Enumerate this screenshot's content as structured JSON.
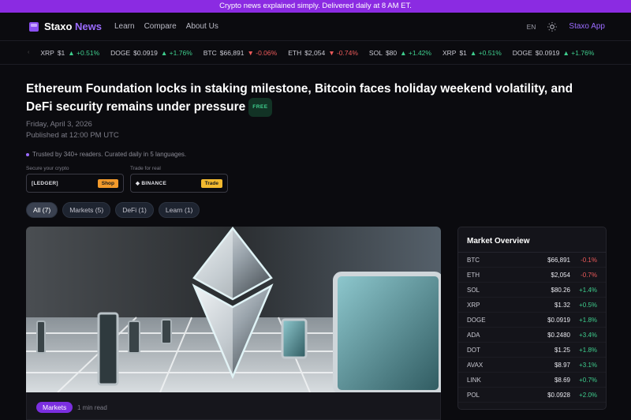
{
  "banner": {
    "text": "Crypto news explained simply. Delivered daily at 8 AM ET."
  },
  "nav": {
    "brand_main": "Staxo",
    "brand_accent": " News",
    "links": [
      "Learn",
      "Compare",
      "About Us"
    ],
    "lang": "EN",
    "theme_icon": "sun-icon",
    "app_link": "Staxo App"
  },
  "ticker": {
    "separator": "‹",
    "items": [
      {
        "sym": "XRP",
        "price": "$1",
        "change": "▲ +0.51%",
        "dir": "up"
      },
      {
        "sym": "DOGE",
        "price": "$0.0919",
        "change": "▲ +1.76%",
        "dir": "up"
      },
      {
        "sym": "BTC",
        "price": "$66,891",
        "change": "▼ -0.06%",
        "dir": "down"
      },
      {
        "sym": "ETH",
        "price": "$2,054",
        "change": "▼ -0.74%",
        "dir": "down"
      },
      {
        "sym": "SOL",
        "price": "$80",
        "change": "▲ +1.42%",
        "dir": "up"
      },
      {
        "sym": "XRP",
        "price": "$1",
        "change": "▲ +0.51%",
        "dir": "up"
      },
      {
        "sym": "DOGE",
        "price": "$0.0919",
        "change": "▲ +1.76%",
        "dir": "up"
      }
    ]
  },
  "article": {
    "headline": "Ethereum Foundation locks in staking milestone, Bitcoin faces holiday weekend volatility, and DeFi security remains under pressure",
    "badge": "FREE",
    "date": "Friday, April 3, 2026",
    "published": "Published at 12:00 PM UTC",
    "trusted": "Trusted by 340+ readers. Curated daily in 5 languages."
  },
  "sponsors": [
    {
      "label": "Secure your crypto",
      "logo": "[LEDGER]",
      "button": "Shop"
    },
    {
      "label": "Trade for real",
      "logo": "◆ BINANCE",
      "button": "Trade"
    }
  ],
  "filters": [
    "All (7)",
    "Markets (5)",
    "DeFi (1)",
    "Learn (1)"
  ],
  "card": {
    "category": "Markets",
    "read_time": "1 min read"
  },
  "market": {
    "title": "Market Overview",
    "rows": [
      {
        "sym": "BTC",
        "price": "$66,891",
        "change": "-0.1%",
        "dir": "down"
      },
      {
        "sym": "ETH",
        "price": "$2,054",
        "change": "-0.7%",
        "dir": "down"
      },
      {
        "sym": "SOL",
        "price": "$80.26",
        "change": "+1.4%",
        "dir": "up"
      },
      {
        "sym": "XRP",
        "price": "$1.32",
        "change": "+0.5%",
        "dir": "up"
      },
      {
        "sym": "DOGE",
        "price": "$0.0919",
        "change": "+1.8%",
        "dir": "up"
      },
      {
        "sym": "ADA",
        "price": "$0.2480",
        "change": "+3.4%",
        "dir": "up"
      },
      {
        "sym": "DOT",
        "price": "$1.25",
        "change": "+1.8%",
        "dir": "up"
      },
      {
        "sym": "AVAX",
        "price": "$8.97",
        "change": "+3.1%",
        "dir": "up"
      },
      {
        "sym": "LINK",
        "price": "$8.69",
        "change": "+0.7%",
        "dir": "up"
      },
      {
        "sym": "POL",
        "price": "$0.0928",
        "change": "+2.0%",
        "dir": "up"
      }
    ]
  },
  "colors": {
    "accent": "#8b2be2",
    "up": "#3fcf8e",
    "down": "#ef5b5b"
  }
}
